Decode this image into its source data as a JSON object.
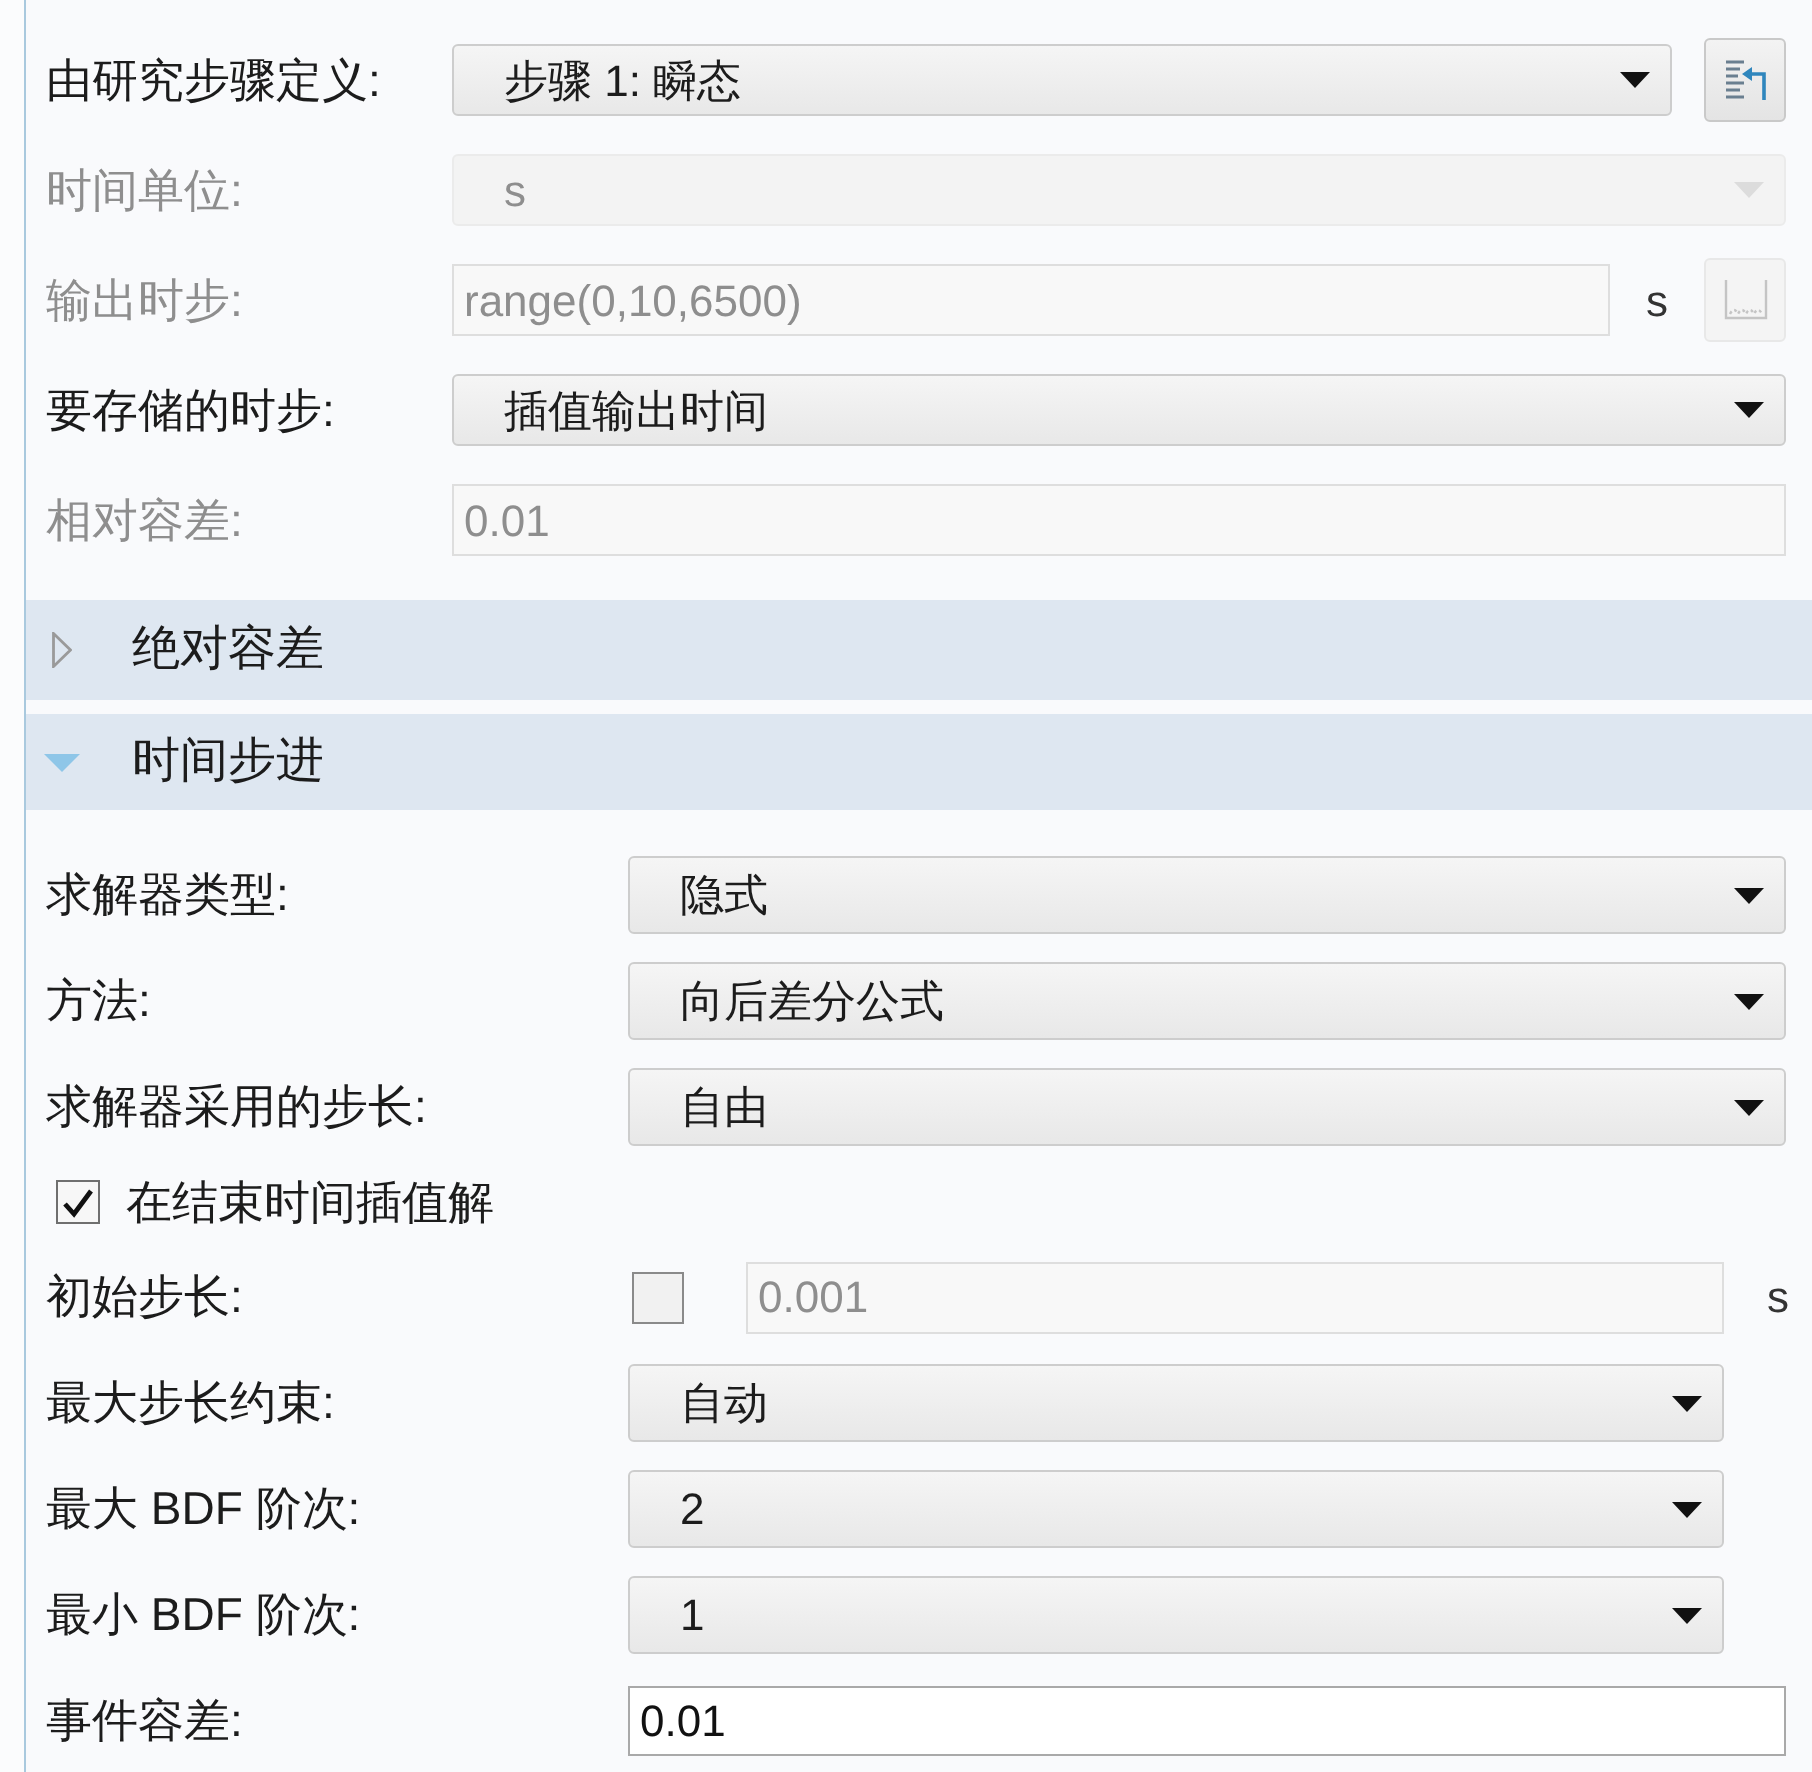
{
  "study": {
    "rows": [
      {
        "kind": "dropdown",
        "label": "由研究步骤定义:",
        "value": "步骤 1: 瞬态",
        "disabled": false,
        "button": {
          "disabled": false
        }
      },
      {
        "kind": "dropdown",
        "label": "时间单位:",
        "value": "s",
        "disabled": true
      },
      {
        "kind": "input",
        "label": "输出时步:",
        "value": "range(0,10,6500)",
        "disabled": true,
        "unit": "s",
        "button": {
          "disabled": true
        }
      },
      {
        "kind": "dropdown",
        "label": "要存储的时步:",
        "value": "插值输出时间",
        "disabled": false
      },
      {
        "kind": "input",
        "label": "相对容差:",
        "value": "0.01",
        "disabled": true
      }
    ]
  },
  "sections": [
    {
      "title": "绝对容差",
      "expanded": false
    },
    {
      "title": "时间步进",
      "expanded": true,
      "rows": [
        {
          "kind": "dropdown",
          "label": "求解器类型:",
          "value": "隐式"
        },
        {
          "kind": "dropdown",
          "label": "方法:",
          "value": "向后差分公式"
        },
        {
          "kind": "dropdown",
          "label": "求解器采用的步长:",
          "value": "自由"
        },
        {
          "kind": "checkbox",
          "label": "在结束时间插值解",
          "checked": true
        },
        {
          "kind": "check_input",
          "label": "初始步长:",
          "checked": false,
          "value": "0.001",
          "disabled": true,
          "unit": "s"
        },
        {
          "kind": "dropdown",
          "label": "最大步长约束:",
          "value": "自动"
        },
        {
          "kind": "dropdown",
          "label": "最大 BDF 阶次:",
          "value": "2"
        },
        {
          "kind": "dropdown",
          "label": "最小 BDF 阶次:",
          "value": "1"
        },
        {
          "kind": "input",
          "label": "事件容差:",
          "value": "0.01",
          "disabled": false
        }
      ]
    }
  ]
}
